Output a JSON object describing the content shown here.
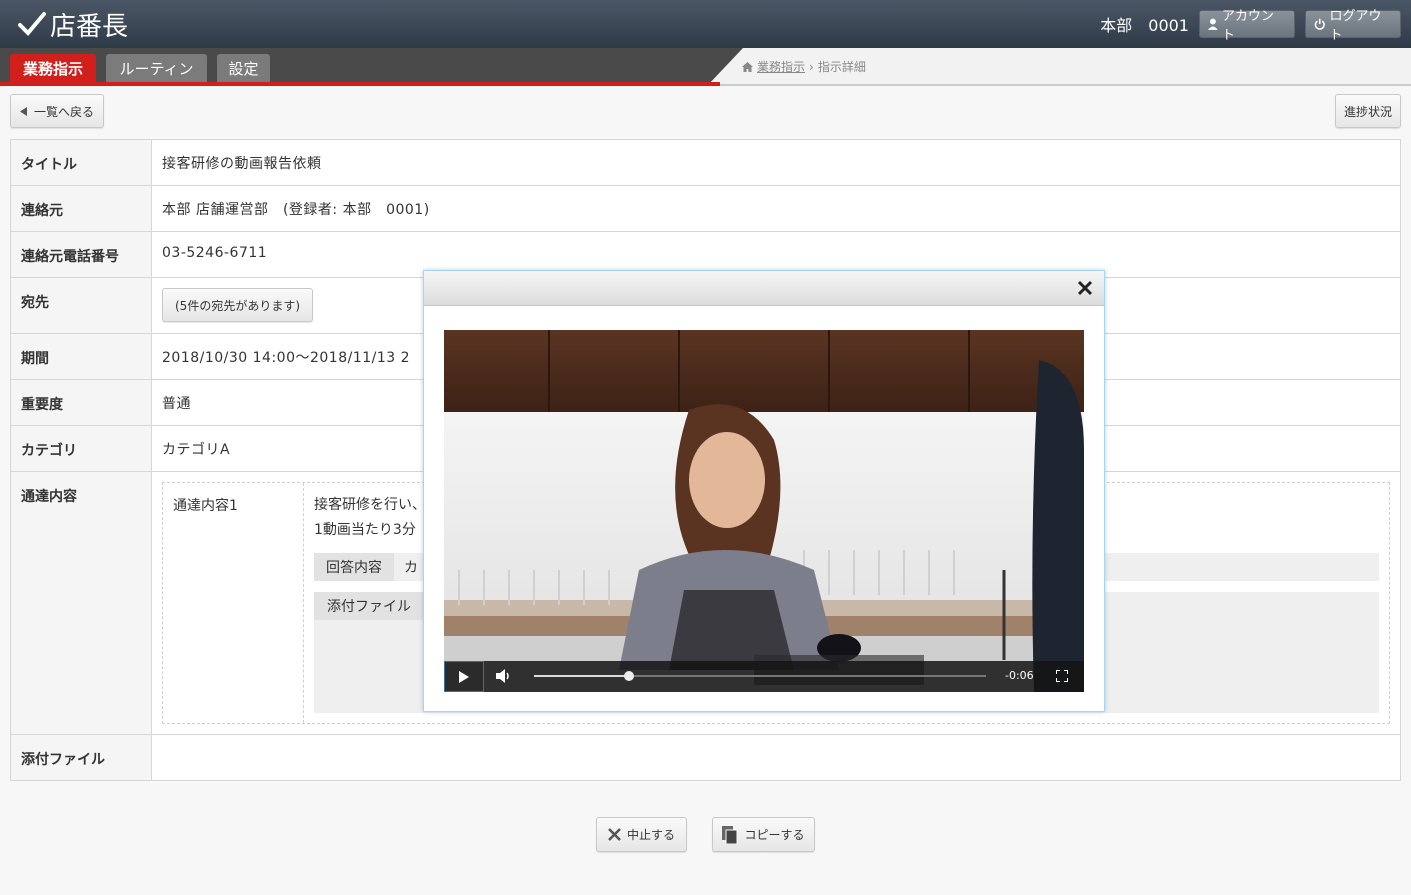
{
  "app": {
    "name": "店番長"
  },
  "header": {
    "user": "本部　0001",
    "account_label": "アカウント",
    "logout_label": "ログアウト"
  },
  "nav": {
    "tabs": [
      "業務指示",
      "ルーティン",
      "設定"
    ],
    "active": 0
  },
  "breadcrumb": {
    "link": "業務指示",
    "current": "指示詳細"
  },
  "toolbar": {
    "back_label": "一覧へ戻る",
    "progress_label": "進捗状況"
  },
  "detail": {
    "title_label": "タイトル",
    "title_value": "接客研修の動画報告依頼",
    "sender_label": "連絡元",
    "sender_value": "本部 店舗運営部　(登録者: 本部　0001)",
    "phone_label": "連絡元電話番号",
    "phone_value": "03-5246-6711",
    "dest_label": "宛先",
    "dest_button": "(5件の宛先があります)",
    "period_label": "期間",
    "period_value": "2018/10/30 14:00～2018/11/13 2",
    "priority_label": "重要度",
    "priority_value": "普通",
    "category_label": "カテゴリ",
    "category_value": "カテゴリA",
    "content_label": "通達内容",
    "content_item_label": "通達内容1",
    "content_line1": "接客研修を行い、",
    "content_line2": "1動画当たり3分",
    "answer_label": "回答内容",
    "answer_value": "カ",
    "attach_inner_label": "添付ファイル",
    "attach_label": "添付ファイル"
  },
  "actions": {
    "stop_label": "中止する",
    "copy_label": "コピーする"
  },
  "video": {
    "time_remaining": "-0:06",
    "progress": 0.21
  }
}
